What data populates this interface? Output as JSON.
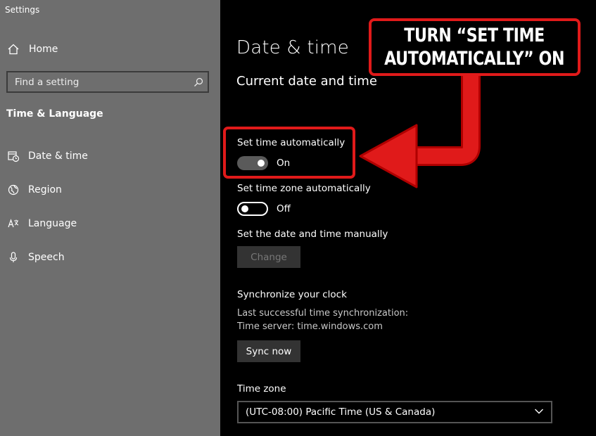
{
  "window": {
    "title": "Settings"
  },
  "sidebar": {
    "home_label": "Home",
    "search_placeholder": "Find a setting",
    "section_title": "Time & Language",
    "items": [
      {
        "label": "Date & time",
        "icon": "date-time-icon"
      },
      {
        "label": "Region",
        "icon": "globe-icon"
      },
      {
        "label": "Language",
        "icon": "language-icon"
      },
      {
        "label": "Speech",
        "icon": "microphone-icon"
      }
    ]
  },
  "main": {
    "title": "Date & time",
    "subtitle": "Current date and time",
    "set_time_auto": {
      "label": "Set time automatically",
      "state": "On"
    },
    "set_zone_auto": {
      "label": "Set time zone automatically",
      "state": "Off"
    },
    "manual": {
      "label": "Set the date and time manually",
      "button": "Change"
    },
    "sync": {
      "heading": "Synchronize your clock",
      "last_sync": "Last successful time synchronization:",
      "server": "Time server: time.windows.com",
      "button": "Sync now"
    },
    "timezone": {
      "heading": "Time zone",
      "value": "(UTC-08:00) Pacific Time (US & Canada)"
    }
  },
  "annotation": {
    "line1": "TURN “SET TIME",
    "line2": "AUTOMATICALLY” ON",
    "color": "#e01a1a"
  }
}
